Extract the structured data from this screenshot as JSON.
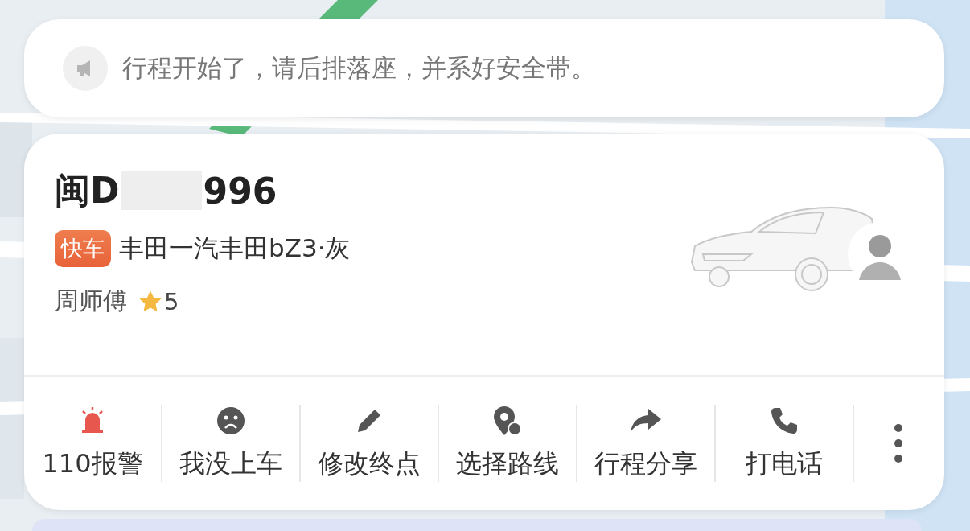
{
  "notice": {
    "text": "行程开始了，请后排落座，并系好安全带。"
  },
  "driver_card": {
    "plate_prefix": "闽D",
    "plate_suffix": "996",
    "service_tag": "快车",
    "car_model": "丰田一汽丰田bZ3·灰",
    "driver_name": "周师傅",
    "rating": "5"
  },
  "actions": [
    {
      "kind": "alarm",
      "label": "110报警"
    },
    {
      "kind": "sad",
      "label": "我没上车"
    },
    {
      "kind": "pencil",
      "label": "修改终点"
    },
    {
      "kind": "pin",
      "label": "选择路线"
    },
    {
      "kind": "share",
      "label": "行程分享"
    },
    {
      "kind": "phone",
      "label": "打电话"
    },
    {
      "kind": "more"
    }
  ]
}
